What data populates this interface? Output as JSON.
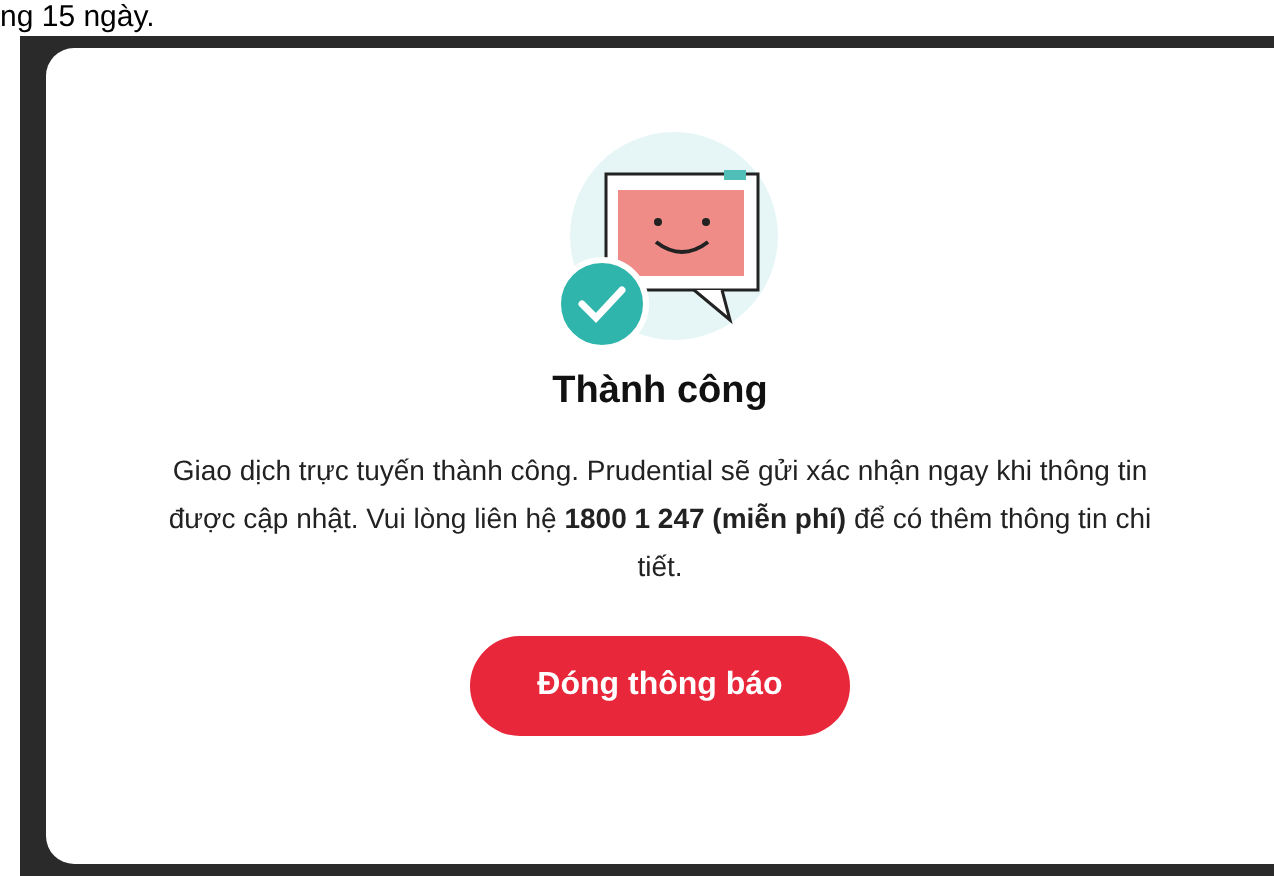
{
  "page_text": "ng 15 ngày.",
  "dialog": {
    "title": "Thành công",
    "message": "Giao dịch trực tuyến thành công. Prudential sẽ gửi xác nhận ngay khi thông tin được cập nhật. Vui lòng liên hệ **1800 1 247 (miễn phí)** để có thêm thông tin chi tiết.",
    "button": "Đóng thông báo"
  }
}
